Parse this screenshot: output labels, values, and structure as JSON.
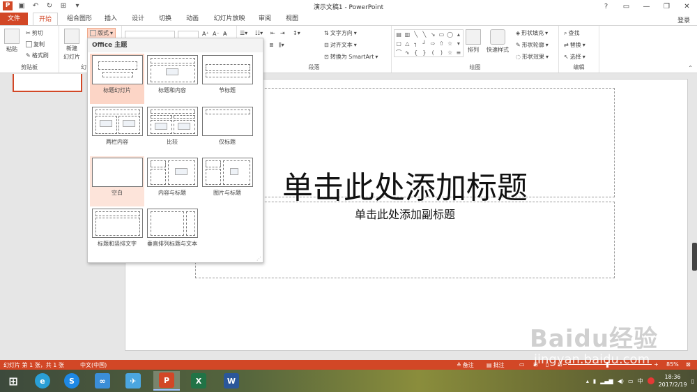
{
  "window": {
    "title": "演示文稿1 - PowerPoint",
    "app_icon": "powerpoint-icon"
  },
  "tabs": {
    "items": [
      "文件",
      "开始",
      "组合图形",
      "插入",
      "设计",
      "切换",
      "动画",
      "幻灯片放映",
      "审阅",
      "视图"
    ],
    "active": "开始",
    "login": "登录"
  },
  "ribbon": {
    "clipboard": {
      "paste": "粘贴",
      "cut": "剪切",
      "copy": "复制",
      "format_painter": "格式刷",
      "label": "剪贴板"
    },
    "slides": {
      "new_slide": "新建",
      "new_slide2": "幻灯片",
      "layout": "版式",
      "label": "幻"
    },
    "paragraph": {
      "text_direction": "文字方向",
      "align_text": "对齐文本",
      "convert_smartart": "转换为 SmartArt",
      "label": "段落"
    },
    "drawing": {
      "arrange": "排列",
      "quick_styles": "快速样式",
      "shape_fill": "形状填充",
      "shape_outline": "形状轮廓",
      "shape_effects": "形状效果",
      "label": "绘图"
    },
    "editing": {
      "find": "查找",
      "replace": "替换",
      "select": "选择",
      "label": "编辑"
    }
  },
  "layout_dropdown": {
    "header": "Office 主题",
    "items": [
      "标题幻灯片",
      "标题和内容",
      "节标题",
      "两栏内容",
      "比较",
      "仅标题",
      "空白",
      "内容与标题",
      "图片与标题",
      "标题和竖排文字",
      "垂直排列标题与文本"
    ],
    "selected": "标题幻灯片",
    "hovered": "空白"
  },
  "slide": {
    "title_placeholder": "单击此处添加标题",
    "subtitle_placeholder": "单击此处添加副标题"
  },
  "statusbar": {
    "slide_info": "幻灯片 第 1 张，共 1 张",
    "language": "中文(中国)",
    "notes": "备注",
    "comments": "批注",
    "zoom": "85%"
  },
  "taskbar": {
    "clock_time": "18:36",
    "clock_date": "2017/2/19",
    "ime": "中"
  },
  "watermark": {
    "text1": "Baidu经验",
    "text2": "jingyan.baidu.com"
  }
}
